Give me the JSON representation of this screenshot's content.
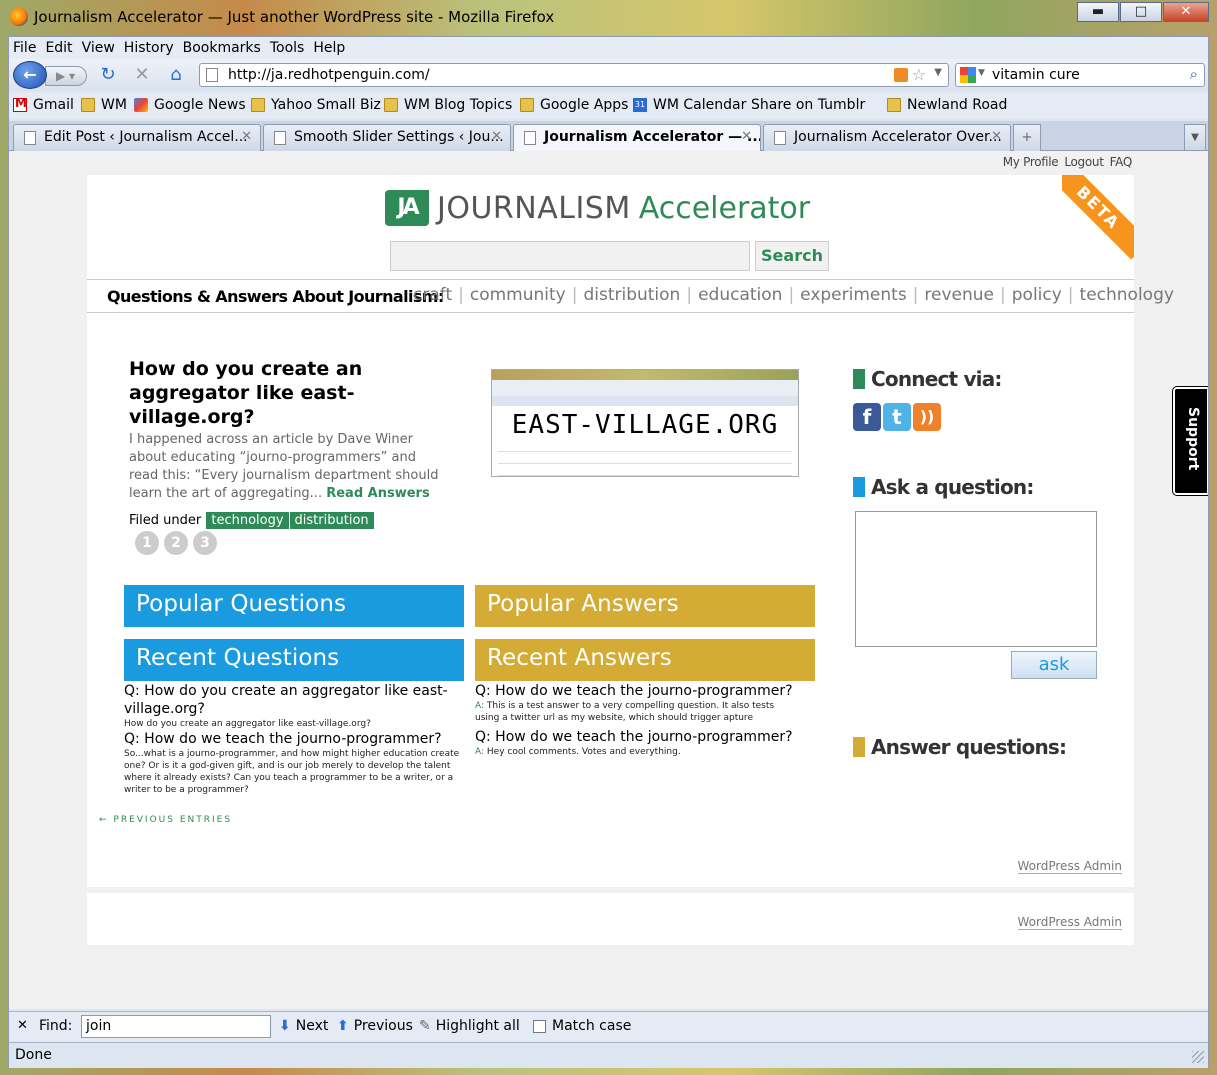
{
  "window": {
    "title": "Journalism Accelerator — Just another WordPress site - Mozilla Firefox",
    "min_glyph": "▬",
    "max_glyph": "□",
    "close_glyph": "✕"
  },
  "menubar": {
    "items": [
      "File",
      "Edit",
      "View",
      "History",
      "Bookmarks",
      "Tools",
      "Help"
    ]
  },
  "navbar": {
    "url": "http://ja.redhotpenguin.com/",
    "search_query": "vitamin cure"
  },
  "bookmarks": [
    {
      "label": "Gmail",
      "icon": "gmail-icon"
    },
    {
      "label": "WM",
      "icon": "folder-icon"
    },
    {
      "label": "Google News",
      "icon": "google-news-icon"
    },
    {
      "label": "Yahoo Small Biz",
      "icon": "folder-icon"
    },
    {
      "label": "WM Blog Topics",
      "icon": "folder-icon"
    },
    {
      "label": "Google Apps",
      "icon": "folder-icon"
    },
    {
      "label": "WM Calendar",
      "icon": "calendar-icon"
    },
    {
      "label": "Share on Tumblr",
      "icon": "page-icon"
    },
    {
      "label": "Newland Road",
      "icon": "folder-icon"
    }
  ],
  "calendar_icon_text": "31",
  "tabs": [
    {
      "label": "Edit Post ‹ Journalism Accel...",
      "active": false
    },
    {
      "label": "Smooth Slider Settings ‹ Jou...",
      "active": false
    },
    {
      "label": "Journalism Accelerator — ...",
      "active": true
    },
    {
      "label": "Journalism Accelerator Over...",
      "active": false
    }
  ],
  "toplinks": [
    "My Profile",
    "Logout",
    "FAQ"
  ],
  "site": {
    "logo_mark": "JA",
    "logo_word1": "JOURNALISM",
    "logo_word2": "Accelerator",
    "beta": "BETA",
    "search_button": "Search",
    "categories_lead": "Questions & Answers About Journalism:",
    "categories": [
      "craft",
      "community",
      "distribution",
      "education",
      "experiments",
      "revenue",
      "policy",
      "technology"
    ]
  },
  "slider": {
    "title": "How do you create an aggregator like east-village.org?",
    "excerpt": "I happened across an article by Dave Winer about educating “journo-programmers” and read this: “Every journalism department should learn the art of aggregating...",
    "read_more": "Read Answers",
    "filed_under": "Filed under",
    "tags": [
      "technology",
      "distribution"
    ],
    "thumb_title": "EAST-VILLAGE.ORG",
    "pages": [
      "1",
      "2",
      "3"
    ]
  },
  "boxes": {
    "popular_questions": "Popular Questions",
    "popular_answers": "Popular Answers",
    "recent_questions": "Recent Questions",
    "recent_answers": "Recent Answers"
  },
  "recent_questions": [
    {
      "q": "Q: How do you create an aggregator like east-village.org?",
      "summary": "How do you create an aggregator like east-village.org?"
    },
    {
      "q": "Q: How do we teach the journo-programmer?",
      "summary": "So...what is a journo-programmer, and how might higher education create one? Or is it a god-given gift, and is our job merely to develop the talent where it already exists? Can you teach a programmer to be a writer, or a writer to be a programmer?"
    }
  ],
  "recent_answers": [
    {
      "q": "Q: How do we teach the journo-programmer?",
      "label": "A:",
      "a": " This is a test answer to a very compelling question. It also tests using a twitter url as my website, which should trigger apture"
    },
    {
      "q": "Q: How do we teach the journo-programmer?",
      "label": "A:",
      "a": " Hey cool comments. Votes and everything."
    }
  ],
  "previous_entries": "← PREVIOUS ENTRIES",
  "wp_admin": "WordPress Admin",
  "sidebar": {
    "connect": "Connect via:",
    "ask": "Ask a question:",
    "ask_button": "ask",
    "answer": "Answer questions:",
    "colors": {
      "connect": "#2e8b57",
      "ask": "#1a9be0",
      "answer": "#d4ab35"
    }
  },
  "support_tab": "Support",
  "findbar": {
    "label": "Find:",
    "value": "join",
    "next": "Next",
    "previous": "Previous",
    "highlight": "Highlight all",
    "match_case": "Match case"
  },
  "status": "Done"
}
